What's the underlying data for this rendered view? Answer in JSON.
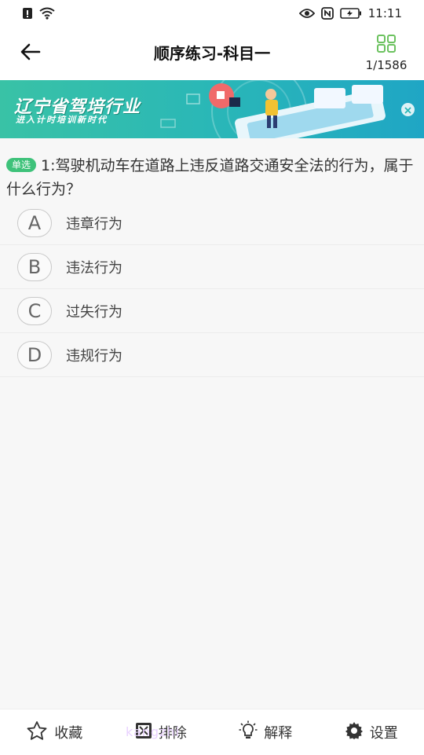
{
  "status_bar": {
    "time": "11:11"
  },
  "header": {
    "title": "顺序练习-科目一",
    "progress": "1/1586"
  },
  "banner": {
    "line1": "辽宁省驾培行业",
    "line2": "进入计时培训新时代"
  },
  "question": {
    "type_badge": "单选",
    "text": "1:驾驶机动车在道路上违反道路交通安全法的行为，属于什么行为？"
  },
  "options": [
    {
      "letter": "A",
      "text": "违章行为"
    },
    {
      "letter": "B",
      "text": "违法行为"
    },
    {
      "letter": "C",
      "text": "过失行为"
    },
    {
      "letter": "D",
      "text": "违规行为"
    }
  ],
  "toolbar": {
    "favorite": "收藏",
    "exclude": "排除",
    "explain": "解释",
    "settings": "设置"
  },
  "watermark": "kangzhi",
  "colors": {
    "accent_green": "#3ec27a",
    "grid_icon_green": "#6cc25f",
    "banner_teal": "#2ab7b7"
  }
}
